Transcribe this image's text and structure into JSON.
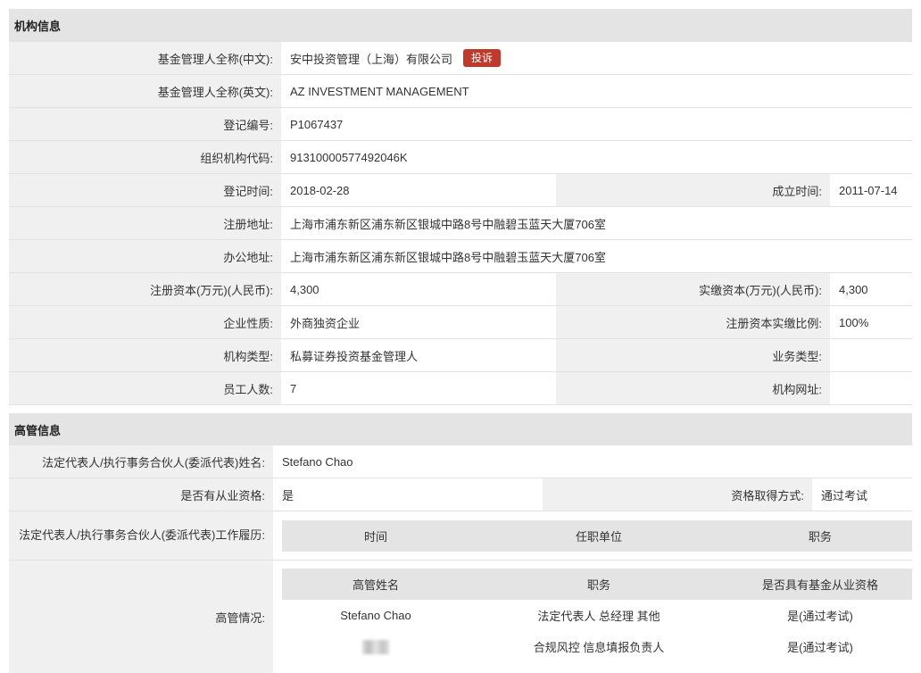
{
  "org_section": {
    "title": "机构信息",
    "name_cn_label": "基金管理人全称(中文):",
    "name_cn_value": "安中投资管理（上海）有限公司",
    "complain_label": "投诉",
    "name_en_label": "基金管理人全称(英文):",
    "name_en_value": "AZ INVESTMENT MANAGEMENT",
    "reg_no_label": "登记编号:",
    "reg_no_value": "P1067437",
    "org_code_label": "组织机构代码:",
    "org_code_value": "91310000577492046K",
    "reg_date_label": "登记时间:",
    "reg_date_value": "2018-02-28",
    "found_date_label": "成立时间:",
    "found_date_value": "2011-07-14",
    "reg_addr_label": "注册地址:",
    "reg_addr_value": "上海市浦东新区浦东新区银城中路8号中融碧玉蓝天大厦706室",
    "office_addr_label": "办公地址:",
    "office_addr_value": "上海市浦东新区浦东新区银城中路8号中融碧玉蓝天大厦706室",
    "reg_capital_label": "注册资本(万元)(人民币):",
    "reg_capital_value": "4,300",
    "paid_capital_label": "实缴资本(万元)(人民币):",
    "paid_capital_value": "4,300",
    "nature_label": "企业性质:",
    "nature_value": "外商独资企业",
    "paid_ratio_label": "注册资本实缴比例:",
    "paid_ratio_value": "100%",
    "org_type_label": "机构类型:",
    "org_type_value": "私募证券投资基金管理人",
    "biz_type_label": "业务类型:",
    "biz_type_value": "",
    "staff_label": "员工人数:",
    "staff_value": "7",
    "website_label": "机构网址:",
    "website_value": ""
  },
  "exec_section": {
    "title": "高管信息",
    "legal_rep_label": "法定代表人/执行事务合伙人(委派代表)姓名:",
    "legal_rep_value": "Stefano Chao",
    "qualified_label": "是否有从业资格:",
    "qualified_value": "是",
    "qual_method_label": "资格取得方式:",
    "qual_method_value": "通过考试",
    "work_history_label": "法定代表人/执行事务合伙人(委派代表)工作履历:",
    "work_history_headers": [
      "时间",
      "任职单位",
      "职务"
    ],
    "execs_label": "高管情况:",
    "execs_headers": [
      "高管姓名",
      "职务",
      "是否具有基金从业资格"
    ],
    "execs_rows": [
      {
        "name": "Stefano Chao",
        "position": "法定代表人 总经理 其他",
        "qualified": "是(通过考试)"
      },
      {
        "name": "",
        "position": "合规风控 信息填报负责人",
        "qualified": "是(通过考试)"
      }
    ]
  }
}
